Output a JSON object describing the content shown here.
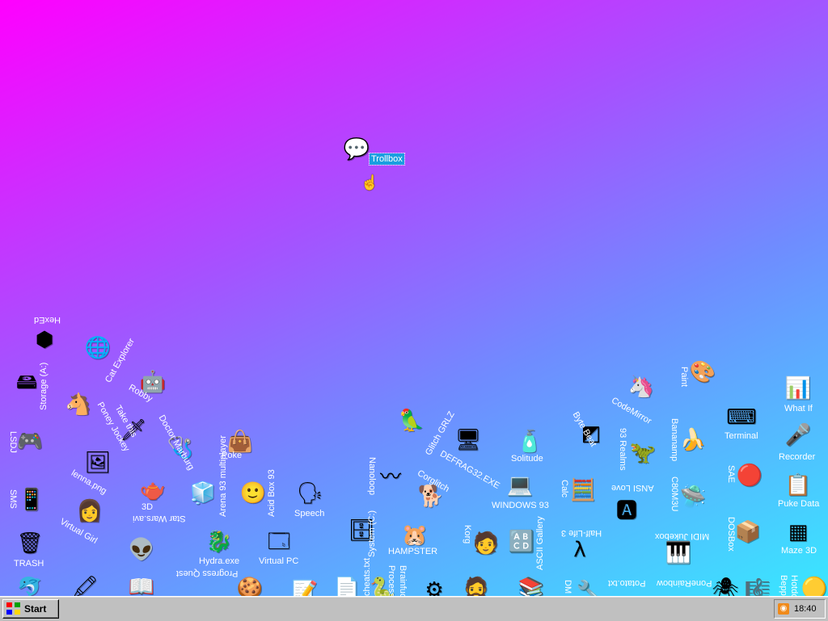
{
  "desktop": {
    "trollbox": {
      "label": "Trollbox",
      "icon": "chat-bubble-smiley-icon"
    },
    "icons": {
      "hexed": "HexEd",
      "storage": "Storage (A:)",
      "cat_explorer": "Cat Explorer",
      "robby": "Robby",
      "lsd": "LSDJ",
      "poney": "Poney Jockey",
      "take_this": "Take this",
      "doctor_marburg": "Doctor Marburg",
      "lenna": "lenna.png",
      "poke": "Poke",
      "sms": "SMS",
      "virtual_girl": "Virtual Girl",
      "three_d": "3D",
      "star_wars": "Star Wars.avi",
      "arena93": "Arena 93 multiplayer",
      "acid_box": "Acid Box 93",
      "speech": "Speech",
      "trash": "TRASH",
      "hydra": "Hydra.exe",
      "virtual_pc": "Virtual PC",
      "progress_quest": "Progress Quest",
      "system_c": "System (C:)",
      "hampster": "HAMPSTER",
      "nanoloop": "Nanoloop",
      "corglitch": "Corglitch",
      "glitch_grlz": "Glitch GRLZ",
      "defrag": "DEFRAG32.EXE",
      "korg": "Korg",
      "ascii_gallery": "ASCII Gallery",
      "solitude": "Solitude",
      "windows93": "WINDOWS 93",
      "byte_beat": "Byte Beat",
      "calc": "Calc",
      "half_life": "Half-Life 3",
      "realms93": "93 Realms",
      "ansi_love": "ANSI Love",
      "codemirror": "CodeMirror",
      "bananamp": "Bananamp",
      "c80m3u": "C80M3U",
      "midi_jukebox": "MIDI Jukebox",
      "potato": "Potato.txt",
      "paint": "Paint",
      "terminal": "Terminal",
      "sae": "SAE",
      "dosbox": "DOSBox",
      "what_if": "What If",
      "recorder": "Recorder",
      "puke_data": "Puke Data",
      "maze3d": "Maze 3D",
      "brainfuck": "Brainfuck",
      "process": "Process",
      "cheats": "cheats.txt",
      "dm": "DM",
      "poneyrainbow": "PoneRainbow",
      "hotdog": "Hotdog",
      "beppu": "Beppu"
    }
  },
  "taskbar": {
    "start_label": "Start",
    "clock": "18:40",
    "tray_icon": "rss-feed-icon",
    "colors": {
      "red": "#ff0000",
      "green": "#00a000",
      "blue": "#0000ff",
      "yellow": "#ffd800"
    }
  }
}
